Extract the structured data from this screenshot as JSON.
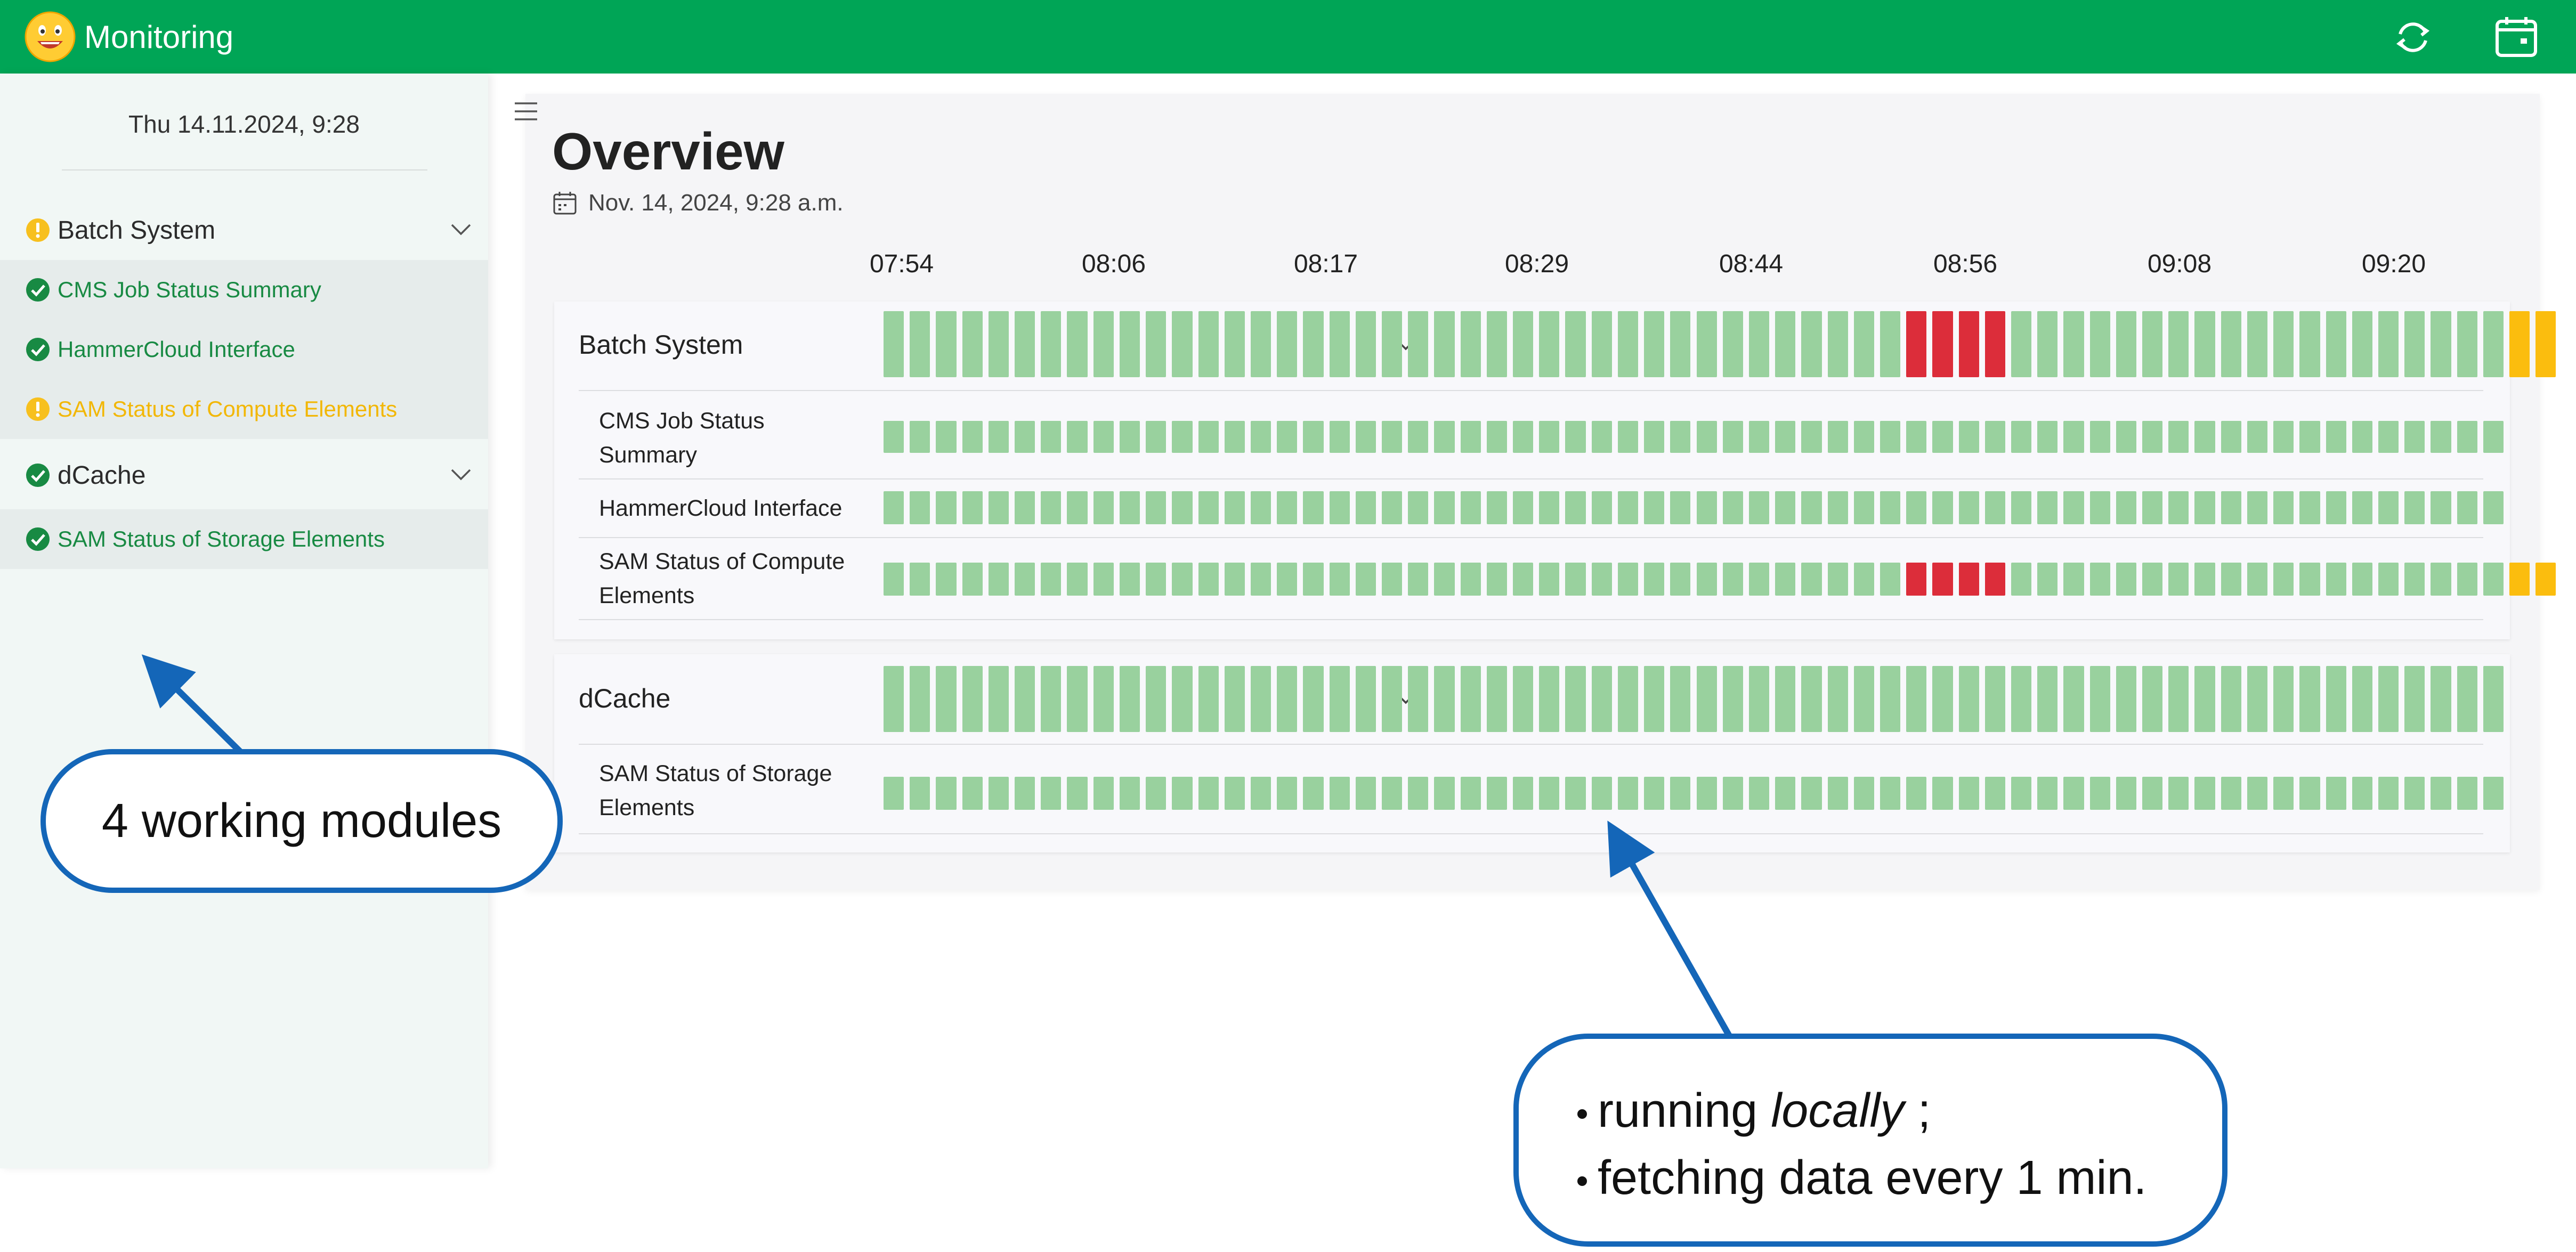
{
  "header": {
    "title": "Monitoring",
    "logo_icon": "smiley-face-icon",
    "refresh_icon": "refresh-icon",
    "calendar_icon": "calendar-icon",
    "bar_color": "#00a556"
  },
  "sidebar": {
    "date": "Thu 14.11.2024, 9:28",
    "groups": [
      {
        "label": "Batch System",
        "status": "warning",
        "items": [
          {
            "label": "CMS Job Status Summary",
            "status": "ok"
          },
          {
            "label": "HammerCloud Interface",
            "status": "ok"
          },
          {
            "label": "SAM Status of Compute Elements",
            "status": "warning"
          }
        ]
      },
      {
        "label": "dCache",
        "status": "ok",
        "items": [
          {
            "label": "SAM Status of Storage Elements",
            "status": "ok"
          }
        ]
      }
    ]
  },
  "main": {
    "title": "Overview",
    "date": "Nov. 14, 2024, 9:28 a.m.",
    "time_labels": [
      "07:54",
      "08:06",
      "08:17",
      "08:29",
      "08:44",
      "08:56",
      "09:08",
      "09:20"
    ],
    "groups": [
      {
        "label": "Batch System",
        "status_pattern": "39 ok, 4 error, 19 ok, 2 warning",
        "subs": [
          {
            "label": "CMS Job Status Summary",
            "status_pattern": "64 ok"
          },
          {
            "label": "HammerCloud Interface",
            "status_pattern": "63 ok"
          },
          {
            "label": "SAM Status of Compute Elements",
            "status_pattern": "39 ok, 4 error, 19 ok, 2 warning"
          }
        ]
      },
      {
        "label": "dCache",
        "status_pattern": "63 ok",
        "subs": [
          {
            "label": "SAM Status of Storage Elements",
            "status_pattern": "63 ok"
          }
        ]
      }
    ]
  },
  "status_colors": {
    "ok": "#99d19e",
    "error": "#dc2d3a",
    "warning": "#fbbd0e"
  },
  "annotations": {
    "modules": "4 working modules",
    "bullets": [
      "running ",
      "locally",
      " ;",
      "fetching data every 1 min."
    ]
  }
}
